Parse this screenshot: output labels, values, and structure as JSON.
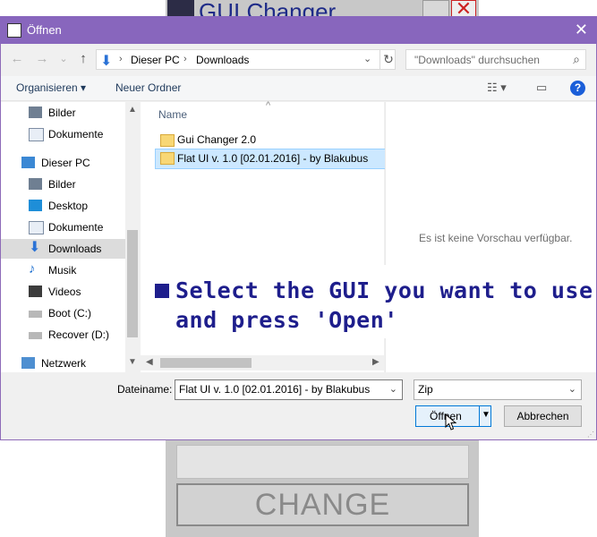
{
  "background_app": {
    "title": "GUI Changer",
    "change_button": "CHANGE",
    "close_glyph": "✕"
  },
  "dialog": {
    "title": "Öffnen",
    "close_glyph": "✕",
    "nav": {
      "back": "←",
      "forward": "→",
      "dropdown": "⌄",
      "up": "↑"
    },
    "breadcrumb": [
      "Dieser PC",
      "Downloads"
    ],
    "search_placeholder": "\"Downloads\" durchsuchen",
    "toolbar": {
      "organize": "Organisieren",
      "new_folder": "Neuer Ordner",
      "help": "?"
    },
    "nav_pane": [
      {
        "label": "Bilder",
        "icon": "pictures-icon",
        "indent": 1
      },
      {
        "label": "Dokumente",
        "icon": "documents-icon",
        "indent": 1
      },
      {
        "label": "Dieser PC",
        "icon": "computer-icon",
        "indent": 0
      },
      {
        "label": "Bilder",
        "icon": "pictures-icon",
        "indent": 1
      },
      {
        "label": "Desktop",
        "icon": "desktop-icon",
        "indent": 1
      },
      {
        "label": "Dokumente",
        "icon": "documents-icon",
        "indent": 1
      },
      {
        "label": "Downloads",
        "icon": "downloads-icon",
        "indent": 1,
        "selected": true
      },
      {
        "label": "Musik",
        "icon": "music-icon",
        "indent": 1
      },
      {
        "label": "Videos",
        "icon": "videos-icon",
        "indent": 1
      },
      {
        "label": "Boot (C:)",
        "icon": "drive-icon",
        "indent": 1
      },
      {
        "label": "Recover (D:)",
        "icon": "drive-icon",
        "indent": 1
      },
      {
        "label": "Netzwerk",
        "icon": "network-icon",
        "indent": 0
      }
    ],
    "file_list": {
      "column_name": "Name",
      "items": [
        {
          "label": "Gui Changer 2.0",
          "icon": "folder-icon"
        },
        {
          "label": "Flat UI v. 1.0 [02.01.2016] - by Blakubus",
          "icon": "zip-folder-icon",
          "selected": true
        }
      ]
    },
    "preview_message": "Es ist keine Vorschau verfügbar.",
    "filename_label": "Dateiname:",
    "filename_value": "Flat UI v. 1.0 [02.01.2016] - by Blakubus",
    "filetype_value": "Zip",
    "open_button": "Öffnen",
    "cancel_button": "Abbrechen"
  },
  "overlay": {
    "instruction_line1": "Select the GUI you want to use",
    "instruction_line2": "and press 'Open'"
  },
  "colors": {
    "titlebar": "#8866bd",
    "accent": "#0078d7",
    "overlay_text": "#1e1e8c",
    "selection": "#cce8ff"
  }
}
